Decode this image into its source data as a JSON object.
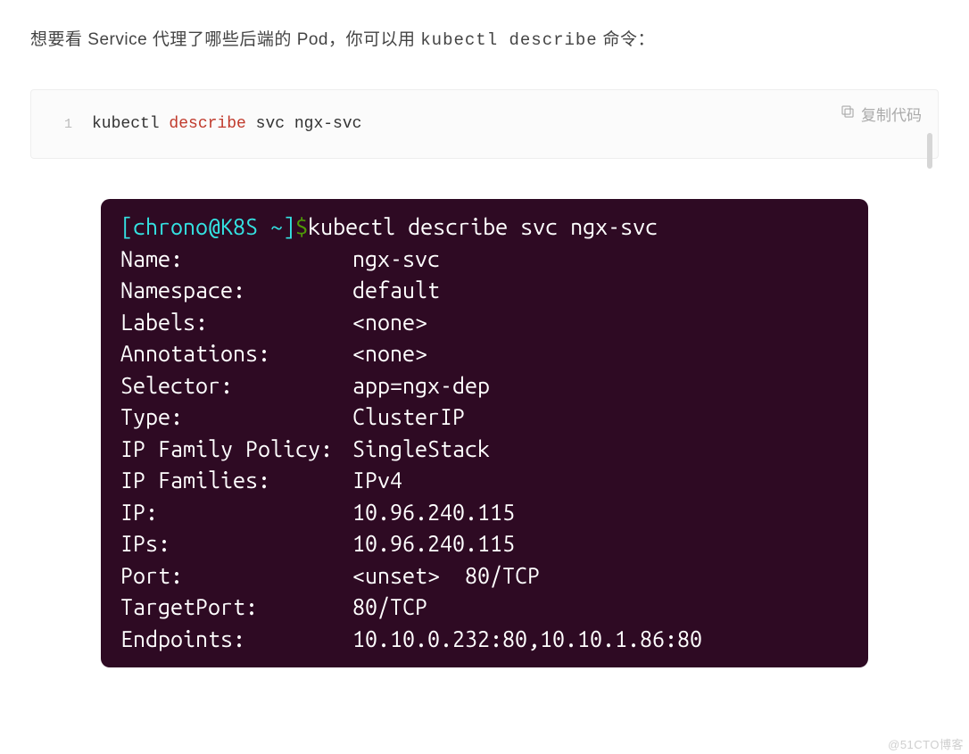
{
  "intro": {
    "prefix": "想要看 Service 代理了哪些后端的 Pod，你可以用 ",
    "command": "kubectl describe",
    "suffix": " 命令："
  },
  "codeblock": {
    "lineno": "1",
    "part1": "kubectl ",
    "keyword": "describe",
    "part2": " svc ngx-svc",
    "copy_label": "复制代码"
  },
  "terminal": {
    "prompt": {
      "open": "[",
      "user": "chrono",
      "at": "@",
      "host": "K8S",
      "space": " ",
      "path": "~",
      "close": "]",
      "dollar": "$"
    },
    "command": "kubectl describe svc ngx-svc",
    "rows": [
      {
        "key": "Name:",
        "value": "ngx-svc"
      },
      {
        "key": "Namespace:",
        "value": "default"
      },
      {
        "key": "Labels:",
        "value": "<none>"
      },
      {
        "key": "Annotations:",
        "value": "<none>"
      },
      {
        "key": "Selector:",
        "value": "app=ngx-dep"
      },
      {
        "key": "Type:",
        "value": "ClusterIP"
      },
      {
        "key": "IP Family Policy:",
        "value": "SingleStack"
      },
      {
        "key": "IP Families:",
        "value": "IPv4"
      },
      {
        "key": "IP:",
        "value": "10.96.240.115"
      },
      {
        "key": "IPs:",
        "value": "10.96.240.115"
      },
      {
        "key": "Port:",
        "value": "<unset>  80/TCP"
      },
      {
        "key": "TargetPort:",
        "value": "80/TCP"
      },
      {
        "key": "Endpoints:",
        "value": "10.10.0.232:80,10.10.1.86:80"
      }
    ]
  },
  "watermark": "@51CTO博客"
}
